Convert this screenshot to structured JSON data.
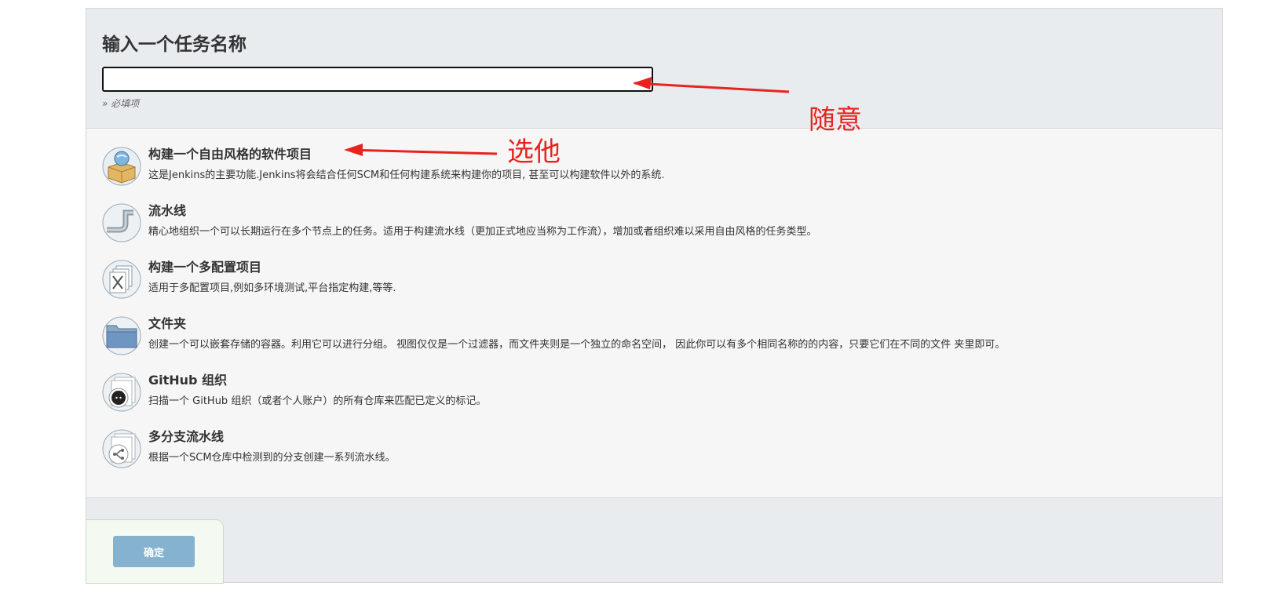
{
  "form": {
    "title": "输入一个任务名称",
    "name_value": "",
    "required_hint": "» 必填项"
  },
  "item_types": [
    {
      "title": "构建一个自由风格的软件项目",
      "description": "这是Jenkins的主要功能.Jenkins将会结合任何SCM和任何构建系统来构建你的项目, 甚至可以构建软件以外的系统.",
      "icon": "freestyle-project-icon"
    },
    {
      "title": "流水线",
      "description": "精心地组织一个可以长期运行在多个节点上的任务。适用于构建流水线（更加正式地应当称为工作流），增加或者组织难以采用自由风格的任务类型。",
      "icon": "pipeline-icon"
    },
    {
      "title": "构建一个多配置项目",
      "description": "适用于多配置项目,例如多环境测试,平台指定构建,等等.",
      "icon": "multi-config-project-icon"
    },
    {
      "title": "文件夹",
      "description": "创建一个可以嵌套存储的容器。利用它可以进行分组。 视图仅仅是一个过滤器，而文件夹则是一个独立的命名空间， 因此你可以有多个相同名称的的内容，只要它们在不同的文件 夹里即可。",
      "icon": "folder-icon"
    },
    {
      "title": "GitHub 组织",
      "description": "扫描一个 GitHub 组织（或者个人账户）的所有仓库来匹配已定义的标记。",
      "icon": "github-organization-icon"
    },
    {
      "title": "多分支流水线",
      "description": "根据一个SCM仓库中检测到的分支创建一系列流水线。",
      "icon": "multibranch-pipeline-icon"
    }
  ],
  "footer": {
    "ok_label": "确定"
  },
  "annotations": {
    "name_note": "随意",
    "type_note": "选他",
    "color": "#e8231f"
  }
}
